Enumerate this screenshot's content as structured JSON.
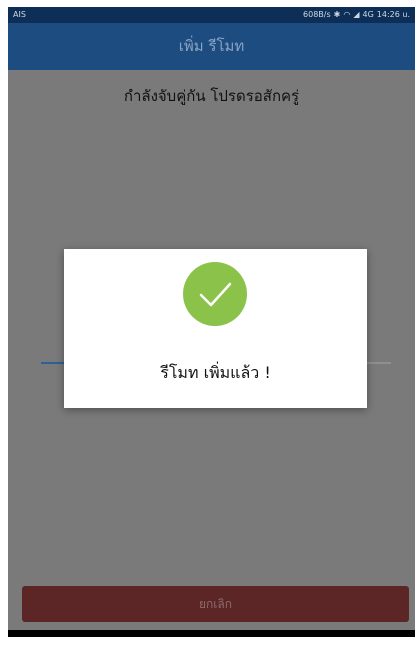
{
  "status_bar": {
    "carrier": "AIS",
    "right_text": "608B/s",
    "network_badge": "4G",
    "time": "14:26 u."
  },
  "header": {
    "title": "เพิ่ม รีโมท"
  },
  "main": {
    "pairing_message": "กำลังจับคู่กัน โปรดรอสักครู่",
    "progress_fraction": 0.5
  },
  "dialog": {
    "icon": "check-icon",
    "message": "รีโมท เพิ่มแล้ว !"
  },
  "footer": {
    "cancel_label": "ยกเลิก"
  },
  "colors": {
    "header": "#1d4c80",
    "status_bar": "#0d2f57",
    "success": "#8bc34a",
    "cancel": "#5c2627"
  }
}
